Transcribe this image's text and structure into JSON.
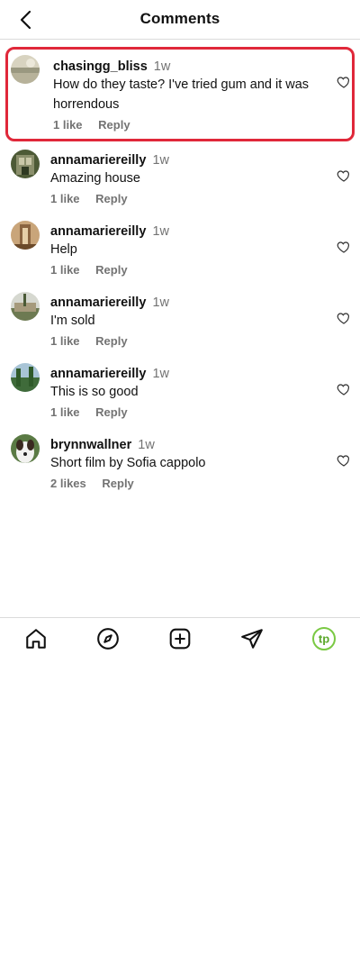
{
  "header": {
    "title": "Comments",
    "back_icon": "chevron-left-icon"
  },
  "comments": [
    {
      "username": "chasingg_bliss",
      "time": "1w",
      "text": "How do they taste? I've tried gum and it was horrendous",
      "likes": "1 like",
      "reply": "Reply",
      "highlighted": true,
      "avatar_colors": [
        "#8a8a6e",
        "#c9c4ae"
      ]
    },
    {
      "username": "annamariereilly",
      "time": "1w",
      "text": "Amazing house",
      "likes": "1 like",
      "reply": "Reply",
      "avatar_colors": [
        "#3f4a2e",
        "#a3a58a"
      ]
    },
    {
      "username": "annamariereilly",
      "time": "1w",
      "text": "Help",
      "likes": "1 like",
      "reply": "Reply",
      "avatar_colors": [
        "#7a5a3a",
        "#d4b48a"
      ]
    },
    {
      "username": "annamariereilly",
      "time": "1w",
      "text": "I'm sold",
      "likes": "1 like",
      "reply": "Reply",
      "avatar_colors": [
        "#5a6a4a",
        "#c8c8b8"
      ]
    },
    {
      "username": "annamariereilly",
      "time": "1w",
      "text": "This is so good",
      "likes": "1 like",
      "reply": "Reply",
      "avatar_colors": [
        "#3a6a3a",
        "#9ab8c8"
      ]
    },
    {
      "username": "brynnwallner",
      "time": "1w",
      "text": "Short film by Sofia cappolo",
      "likes": "2 likes",
      "reply": "Reply",
      "avatar_colors": [
        "#4a6a3a",
        "#f0f0f0"
      ]
    }
  ],
  "bottom_nav": [
    {
      "name": "home-icon"
    },
    {
      "name": "explore-compass-icon"
    },
    {
      "name": "create-plus-icon"
    },
    {
      "name": "direct-send-icon"
    },
    {
      "name": "profile-avatar-icon",
      "label": "tp",
      "accent": "#7ac943"
    }
  ],
  "colors": {
    "highlight_border": "#e0283a",
    "secondary_text": "#737373",
    "divider": "#dbdbdb"
  }
}
